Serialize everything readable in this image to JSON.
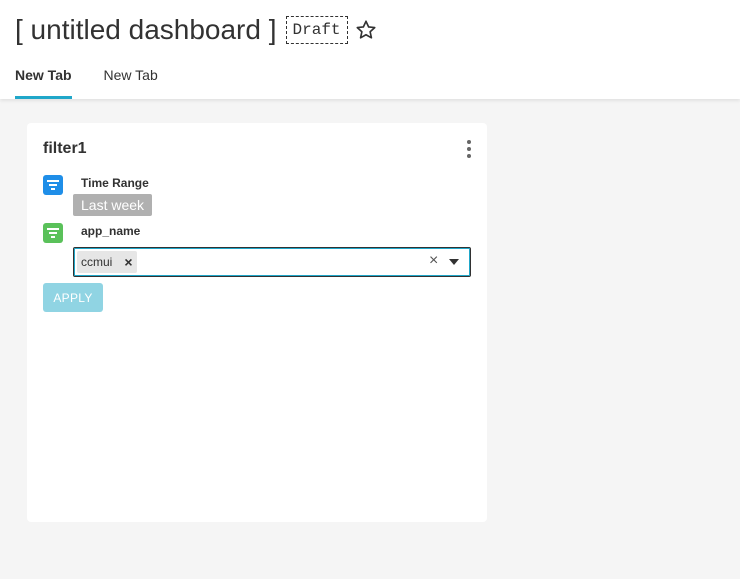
{
  "dashboard": {
    "title": "[ untitled dashboard ]",
    "status_badge": "Draft"
  },
  "tabs": [
    {
      "label": "New Tab",
      "active": true
    },
    {
      "label": "New Tab",
      "active": false
    }
  ],
  "colors": {
    "accent": "#20a7c9",
    "filter_time_icon": "#1f8ee8",
    "filter_select_icon": "#5ac15a",
    "apply_disabled": "#90d4e3"
  },
  "filter_card": {
    "title": "filter1",
    "menu_icon": "more-vertical-icon",
    "filters": [
      {
        "icon": "filter-icon",
        "label": "Time Range",
        "value": "Last week"
      },
      {
        "icon": "filter-icon",
        "label": "app_name",
        "selected": [
          "ccmui"
        ]
      }
    ],
    "apply_label": "APPLY"
  }
}
